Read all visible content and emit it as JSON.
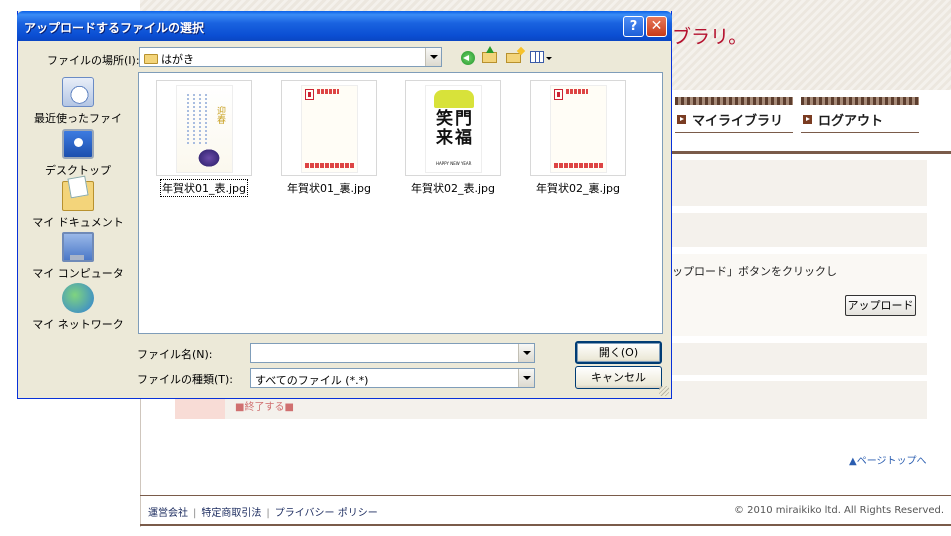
{
  "webpage": {
    "site_title": "ブラリ。",
    "nav": [
      {
        "label": "マイライブラリ"
      },
      {
        "label": "ログアウト"
      }
    ],
    "content_text": "ップロード」ボタンをクリックし",
    "upload_button": "アップロード",
    "pink_link": "■終了する■",
    "page_top": "▲ページトップへ",
    "footer_links": [
      "運営会社",
      "特定商取引法",
      "プライバシー ポリシー"
    ],
    "copyright": "© 2010 miraikiko ltd. All Rights Reserved."
  },
  "dialog": {
    "title": "アップロードするファイルの選択",
    "help_glyph": "?",
    "close_glyph": "✕",
    "lookin_label": "ファイルの場所(I):",
    "lookin_value": "はがき",
    "places": [
      {
        "label": "最近使ったファイル",
        "icon": "recent-documents-icon"
      },
      {
        "label": "デスクトップ",
        "icon": "desktop-icon"
      },
      {
        "label": "マイ ドキュメント",
        "icon": "my-documents-icon"
      },
      {
        "label": "マイ コンピュータ",
        "icon": "my-computer-icon"
      },
      {
        "label": "マイ ネットワーク",
        "icon": "my-network-icon"
      }
    ],
    "files": [
      {
        "name": "年賀状01_表.jpg",
        "selected": true
      },
      {
        "name": "年賀状01_裏.jpg",
        "selected": false
      },
      {
        "name": "年賀状02_表.jpg",
        "selected": false
      },
      {
        "name": "年賀状02_裏.jpg",
        "selected": false
      }
    ],
    "card_kanji": "笑門来福",
    "card_happy": "HAPPY NEW YEAR",
    "card1_char": "迎春",
    "filename_label": "ファイル名(N):",
    "filename_value": "",
    "filetype_label": "ファイルの種類(T):",
    "filetype_value": "すべてのファイル (*.*)",
    "open_button": "開く(O)",
    "cancel_button": "キャンセル"
  }
}
